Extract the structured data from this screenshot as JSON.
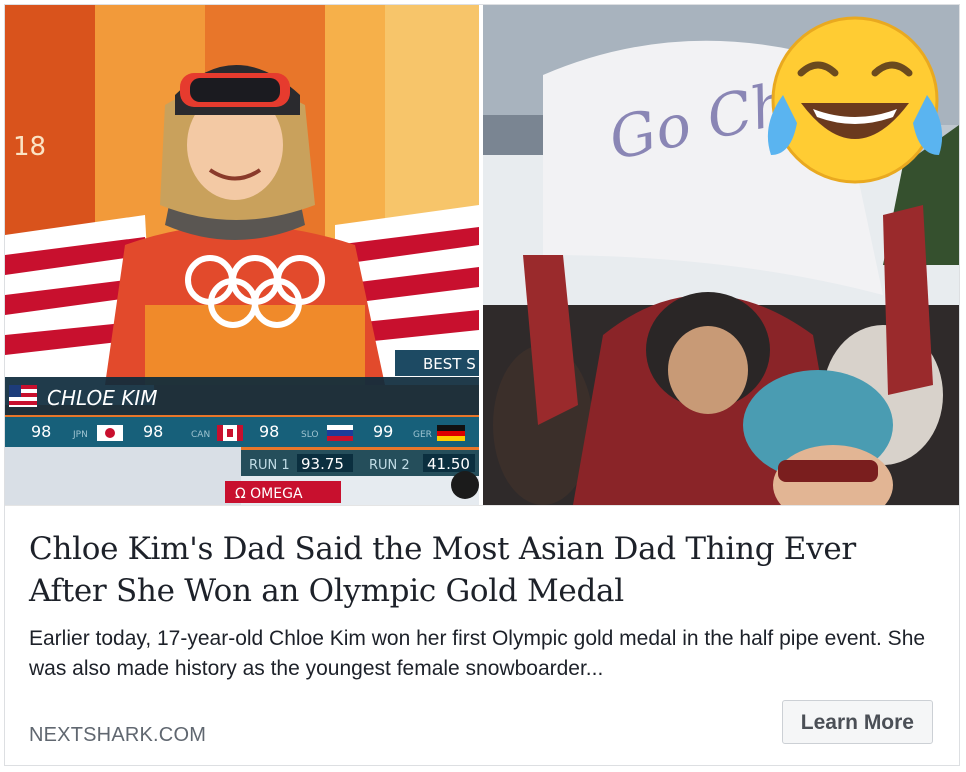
{
  "media": {
    "left_photo": {
      "lower_third": {
        "name": "CHLOE KIM",
        "corner_text": "BEST S",
        "scores": [
          {
            "country": "",
            "value": "98"
          },
          {
            "country": "JPN",
            "value": "98"
          },
          {
            "country": "CAN",
            "value": "98"
          },
          {
            "country": "SLO",
            "value": "99"
          },
          {
            "country": "GER",
            "value": ""
          }
        ],
        "run1_label": "RUN 1",
        "run1_value": "93.75",
        "run2_label": "RUN 2",
        "run2_value": "41.50",
        "sponsor": "Ω OMEGA",
        "background_number": "18"
      }
    },
    "right_photo": {
      "sign_text": "Go Chloe!",
      "emoji": "face-with-tears-of-joy"
    }
  },
  "link": {
    "headline": "Chloe Kim's Dad Said the Most Asian Dad Thing Ever After She Won an Olympic Gold Medal",
    "description": "Earlier today, 17-year-old Chloe Kim won her first Olympic gold medal in the half pipe event. She was also made history as the youngest female snowboarder...",
    "domain": "NEXTSHARK.COM",
    "cta_label": "Learn More"
  },
  "colors": {
    "headline": "#1d2129",
    "domain": "#606770",
    "button_bg": "#f5f6f7"
  }
}
